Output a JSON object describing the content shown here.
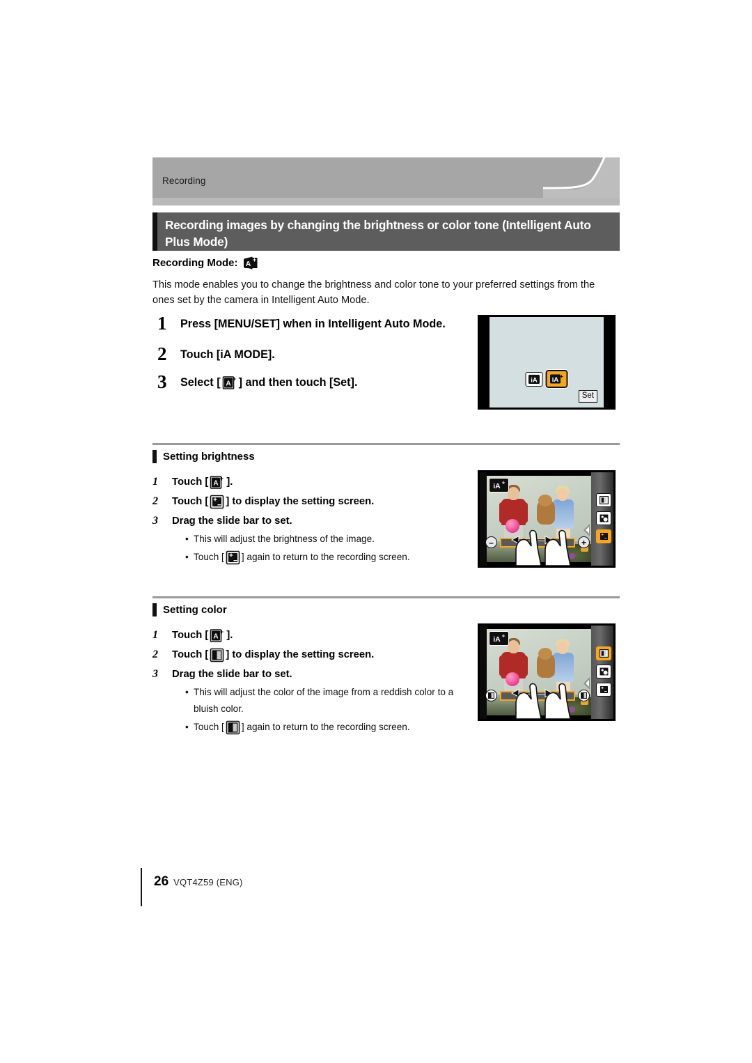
{
  "tab": {
    "label": "Recording"
  },
  "title": {
    "text": "Recording images by changing the brightness or color tone (Intelligent Auto Plus Mode)"
  },
  "recording_mode": {
    "label": "Recording Mode:",
    "icon": "ia-plus-icon"
  },
  "intro": {
    "text": "This mode enables you to change the brightness and color tone to your preferred settings from the ones set by the camera in Intelligent Auto Mode."
  },
  "steps": [
    {
      "num": "1",
      "text": "Press [MENU/SET] when in Intelligent Auto Mode."
    },
    {
      "num": "2",
      "text": "Touch [iA MODE]."
    },
    {
      "num": "3",
      "text_before": "Select [",
      "icon": "ia-plus-icon",
      "text_after": "] and then touch [Set]."
    }
  ],
  "menu_screen": {
    "option_plain": "iA",
    "option_selected": "iA+",
    "set_label": "Set"
  },
  "sections": [
    {
      "heading": "Setting brightness",
      "steps": [
        {
          "num": "1",
          "before": "Touch [",
          "icon": "ia-plus-icon",
          "after": "]."
        },
        {
          "num": "2",
          "before": "Touch [",
          "icon": "brightness-icon",
          "after": "] to display the setting screen."
        },
        {
          "num": "3",
          "before": "Drag the slide bar to set.",
          "icon": "",
          "after": ""
        }
      ],
      "bullets": [
        {
          "before": "This will adjust the brightness of the image.",
          "icon": "",
          "after": ""
        },
        {
          "before": "Touch [",
          "icon": "brightness-icon",
          "after": "] again to return to the recording screen."
        }
      ],
      "screen": {
        "badge": "iA+",
        "side_icons": [
          "color-icon",
          "defocus-icon",
          "brightness-icon"
        ],
        "highlighted_side_icon": "brightness-icon",
        "slider_left": "–",
        "slider_right": "+"
      }
    },
    {
      "heading": "Setting color",
      "steps": [
        {
          "num": "1",
          "before": "Touch [",
          "icon": "ia-plus-icon",
          "after": "]."
        },
        {
          "num": "2",
          "before": "Touch [",
          "icon": "color-icon",
          "after": "] to display the setting screen."
        },
        {
          "num": "3",
          "before": "Drag the slide bar to set.",
          "icon": "",
          "after": ""
        }
      ],
      "bullets": [
        {
          "before": "This will adjust the color of the image from a reddish color to a bluish color.",
          "icon": "",
          "after": ""
        },
        {
          "before": "Touch [",
          "icon": "color-icon",
          "after": "] again to return to the recording screen."
        }
      ],
      "screen": {
        "badge": "iA+",
        "side_icons": [
          "color-icon",
          "defocus-icon",
          "brightness-icon"
        ],
        "highlighted_side_icon": "color-icon",
        "slider_left": "color-swatch",
        "slider_right": "color-swatch"
      }
    }
  ],
  "footer": {
    "page": "26",
    "code": "VQT4Z59 (ENG)"
  },
  "colors": {
    "tab_band": "#a6a6a6",
    "tab_under": "#b9b9b9",
    "title_bar": "#5d5d5d",
    "accent_orange": "#f5a623",
    "rule": "#9a9a9a"
  }
}
